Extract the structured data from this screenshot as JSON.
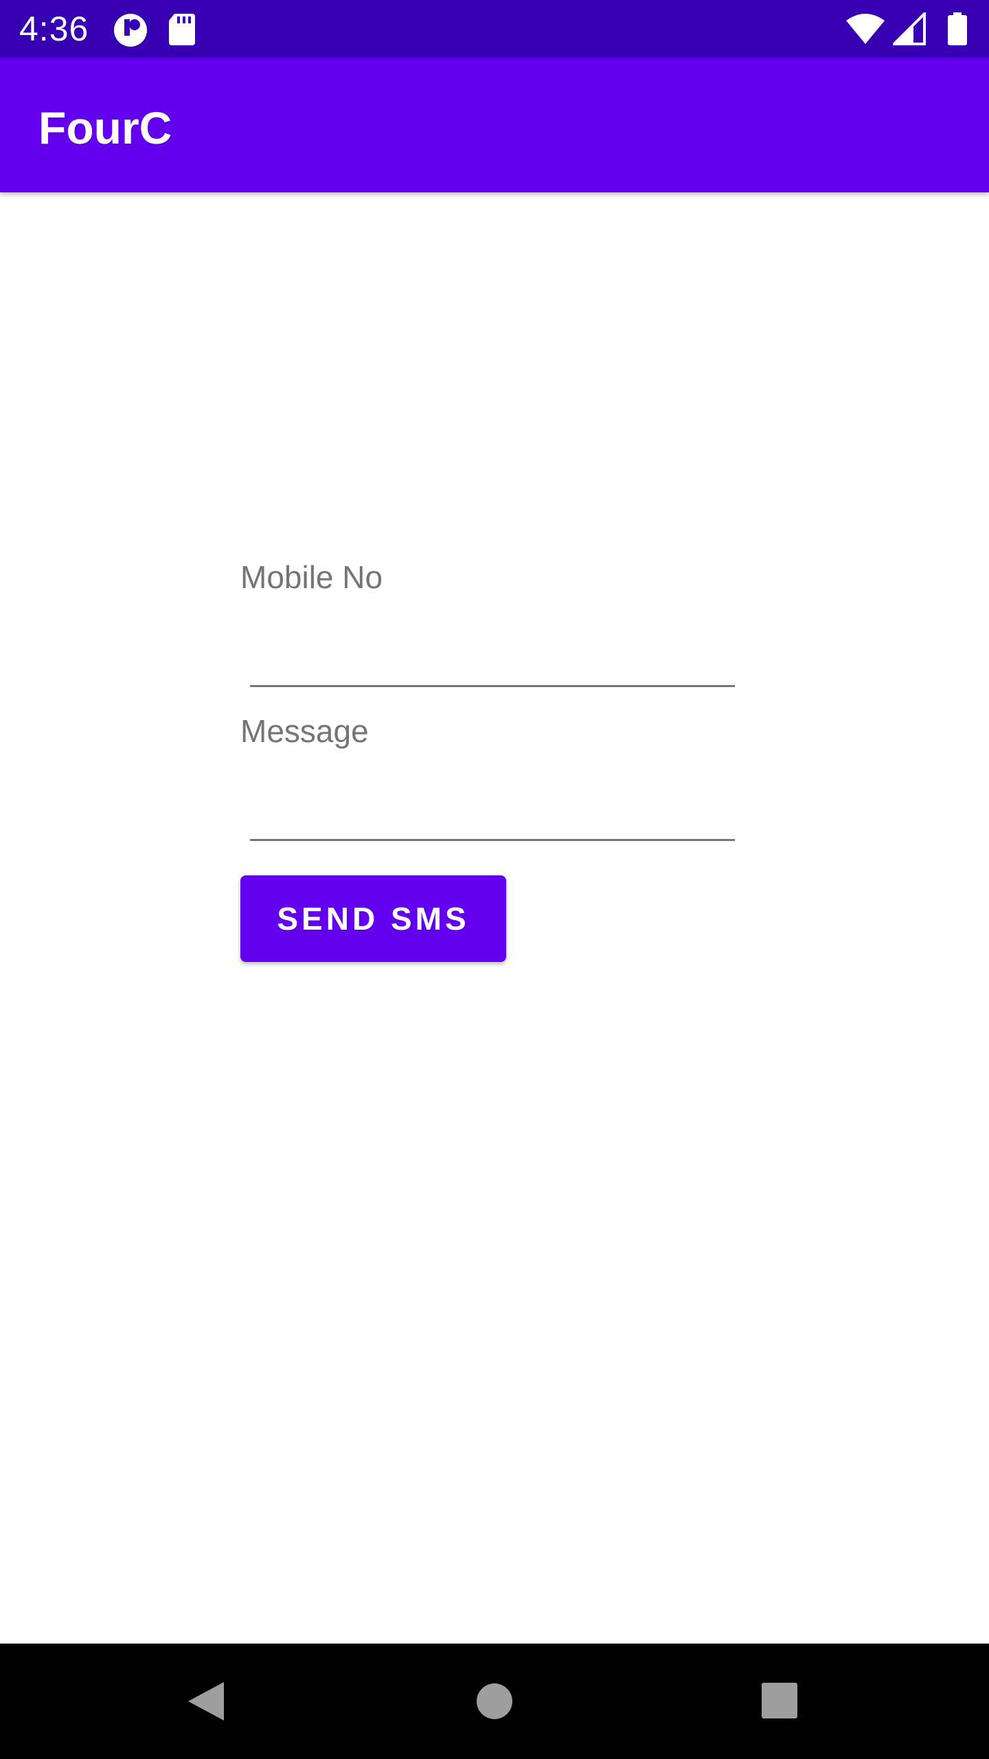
{
  "status_bar": {
    "time": "4:36",
    "left_icons": [
      "app-notification-icon",
      "sd-card-icon"
    ],
    "right_icons": [
      "wifi-icon",
      "cellular-signal-icon",
      "battery-icon"
    ],
    "background": "#3700b3"
  },
  "app_bar": {
    "title": "FourC",
    "background": "#6200ee"
  },
  "form": {
    "mobile_label": "Mobile No",
    "mobile_value": "",
    "message_label": "Message",
    "message_value": "",
    "send_button_label": "SEND SMS",
    "accent": "#6200ee"
  },
  "nav_bar": {
    "icons": [
      "back-icon",
      "home-icon",
      "recents-icon"
    ]
  }
}
